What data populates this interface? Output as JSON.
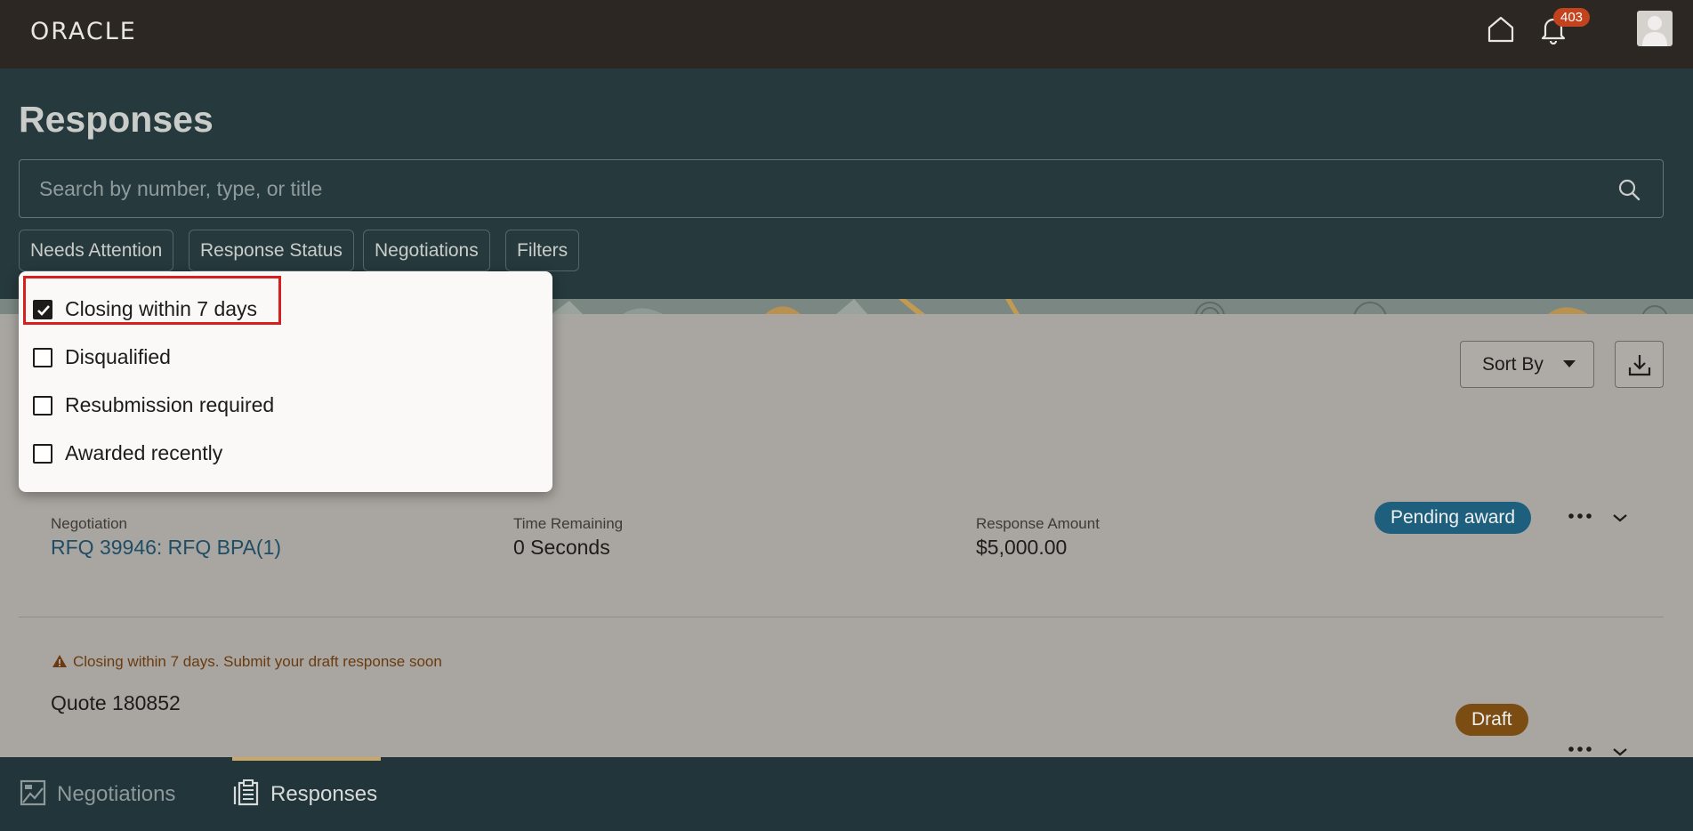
{
  "topbar": {
    "logo": "ORACLE",
    "notification_count": "403"
  },
  "header": {
    "title": "Responses",
    "search_placeholder": "Search by number, type, or title",
    "chips": [
      "Needs Attention",
      "Response Status",
      "Negotiations",
      "Filters"
    ]
  },
  "dropdown": {
    "options": [
      {
        "label": "Closing within 7 days",
        "checked": true
      },
      {
        "label": "Disqualified",
        "checked": false
      },
      {
        "label": "Resubmission required",
        "checked": false
      },
      {
        "label": "Awarded recently",
        "checked": false
      }
    ]
  },
  "toolbar": {
    "sort_label": "Sort By"
  },
  "results": [
    {
      "negotiation_label": "Negotiation",
      "negotiation_value": "RFQ 39946: RFQ BPA(1)",
      "time_label": "Time Remaining",
      "time_value": "0 Seconds",
      "amount_label": "Response Amount",
      "amount_value": "$5,000.00",
      "status": "Pending award",
      "status_color": "#1f5f7e"
    },
    {
      "warning": "Closing within 7 days. Submit your draft response soon",
      "title": "Quote 180852",
      "status": "Draft",
      "status_color": "#7b4d12"
    }
  ],
  "bottomnav": {
    "items": [
      "Negotiations",
      "Responses"
    ]
  }
}
